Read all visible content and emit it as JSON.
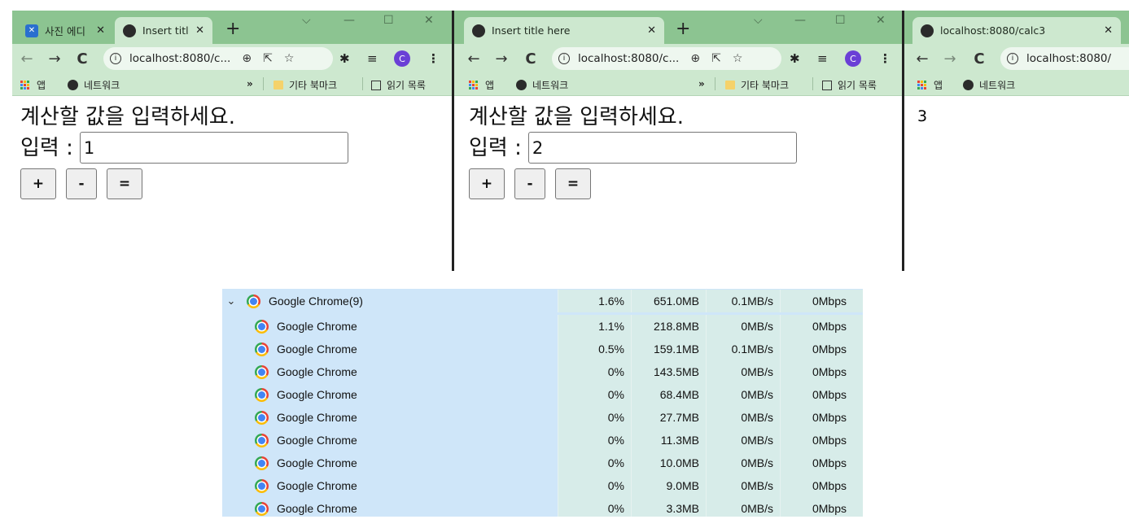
{
  "windows": [
    {
      "tabs": [
        {
          "title": "사진 에디",
          "icon": "photo-editor-icon",
          "active": false
        },
        {
          "title": "Insert titl",
          "icon": "globe-icon",
          "active": true
        }
      ],
      "address": "localhost:8080/c...",
      "profile_initial": "C",
      "bookmarks": {
        "apps": "앱",
        "network": "네트워크",
        "overflow": "»",
        "other": "기타 북마크",
        "reading_list": "읽기 목록"
      },
      "page": {
        "heading": "계산할 값을 입력하세요.",
        "input_label": "입력 :",
        "input_value": "1",
        "buttons": [
          "+",
          "-",
          "="
        ]
      }
    },
    {
      "tabs": [
        {
          "title": "Insert title here",
          "icon": "globe-icon",
          "active": true
        }
      ],
      "address": "localhost:8080/c...",
      "profile_initial": "C",
      "bookmarks": {
        "apps": "앱",
        "network": "네트워크",
        "overflow": "»",
        "other": "기타 북마크",
        "reading_list": "읽기 목록"
      },
      "page": {
        "heading": "계산할 값을 입력하세요.",
        "input_label": "입력 :",
        "input_value": "2",
        "buttons": [
          "+",
          "-",
          "="
        ]
      }
    },
    {
      "tabs": [
        {
          "title": "localhost:8080/calc3",
          "icon": "globe-icon",
          "active": true
        }
      ],
      "address": "localhost:8080/",
      "bookmarks": {
        "apps": "앱",
        "network": "네트워크"
      },
      "page": {
        "result": "3"
      }
    }
  ],
  "task_manager": {
    "group": {
      "name": "Google Chrome(9)",
      "cpu": "1.6%",
      "memory": "651.0MB",
      "disk": "0.1MB/s",
      "network": "0Mbps"
    },
    "processes": [
      {
        "name": "Google Chrome",
        "cpu": "1.1%",
        "memory": "218.8MB",
        "disk": "0MB/s",
        "network": "0Mbps"
      },
      {
        "name": "Google Chrome",
        "cpu": "0.5%",
        "memory": "159.1MB",
        "disk": "0.1MB/s",
        "network": "0Mbps"
      },
      {
        "name": "Google Chrome",
        "cpu": "0%",
        "memory": "143.5MB",
        "disk": "0MB/s",
        "network": "0Mbps"
      },
      {
        "name": "Google Chrome",
        "cpu": "0%",
        "memory": "68.4MB",
        "disk": "0MB/s",
        "network": "0Mbps"
      },
      {
        "name": "Google Chrome",
        "cpu": "0%",
        "memory": "27.7MB",
        "disk": "0MB/s",
        "network": "0Mbps"
      },
      {
        "name": "Google Chrome",
        "cpu": "0%",
        "memory": "11.3MB",
        "disk": "0MB/s",
        "network": "0Mbps"
      },
      {
        "name": "Google Chrome",
        "cpu": "0%",
        "memory": "10.0MB",
        "disk": "0MB/s",
        "network": "0Mbps"
      },
      {
        "name": "Google Chrome",
        "cpu": "0%",
        "memory": "9.0MB",
        "disk": "0MB/s",
        "network": "0Mbps"
      },
      {
        "name": "Google Chrome",
        "cpu": "0%",
        "memory": "3.3MB",
        "disk": "0MB/s",
        "network": "0Mbps"
      }
    ]
  }
}
